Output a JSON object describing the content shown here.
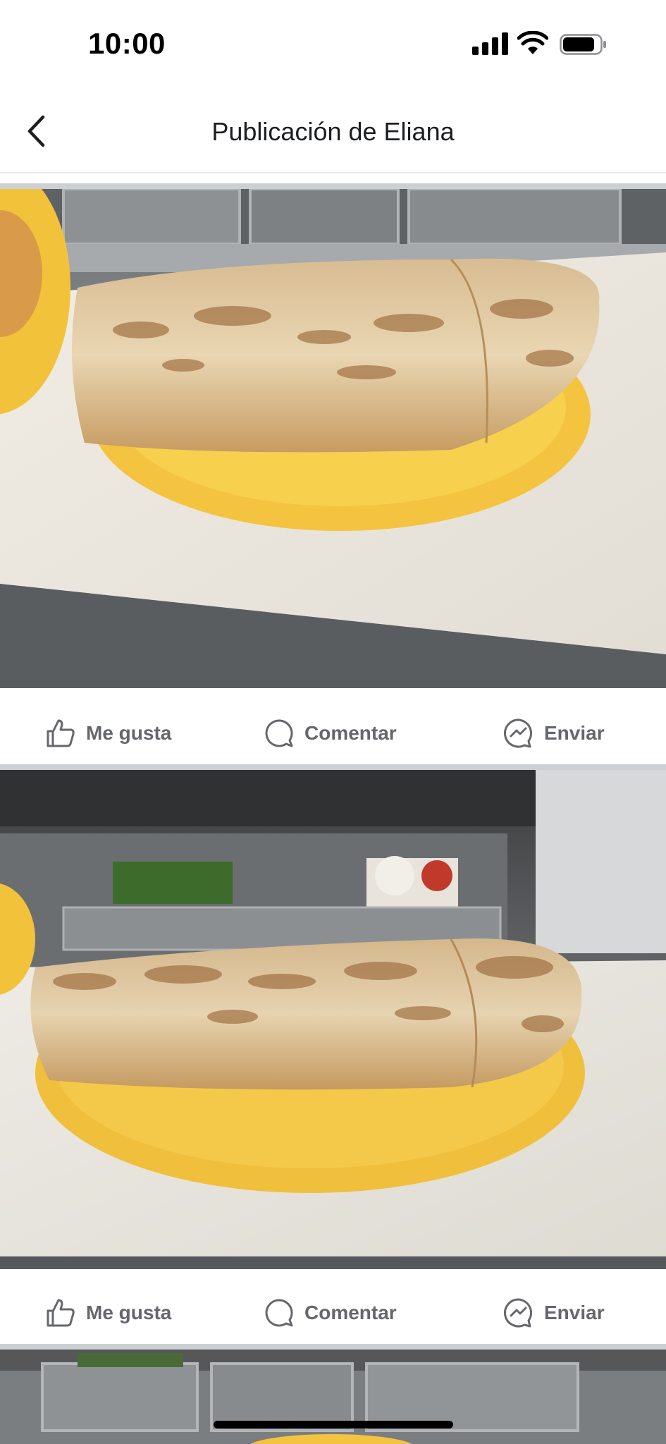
{
  "status_bar": {
    "time": "10:00"
  },
  "header": {
    "title": "Publicación de Eliana"
  },
  "actions": {
    "like": "Me gusta",
    "comment": "Comentar",
    "send": "Enviar"
  },
  "colors": {
    "plate": "#f4c440",
    "tortilla": "#e6d2ae",
    "steel": "#9a9d9f",
    "action_text": "#65676b",
    "divider": "#ccd0d5"
  },
  "icons": [
    "chevron-left-icon",
    "signal-icon",
    "wifi-icon",
    "battery-icon",
    "like-icon",
    "comment-icon",
    "messenger-icon"
  ]
}
